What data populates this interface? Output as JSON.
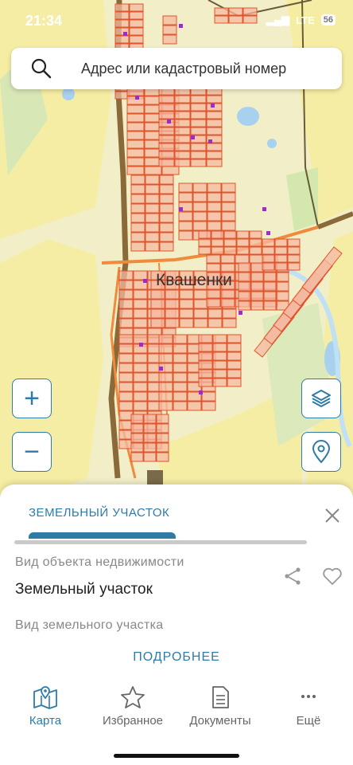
{
  "status_bar": {
    "time": "21:34",
    "network": "LTE",
    "battery": "56"
  },
  "search": {
    "placeholder": "Адрес или кадастровый номер"
  },
  "map": {
    "place_label": "Квашенки"
  },
  "map_controls": {
    "zoom_in": "+",
    "zoom_out": "−"
  },
  "sheet": {
    "tab_label": "ЗЕМЕЛЬНЫЙ УЧАСТОК",
    "field1_label": "Вид объекта недвижимости",
    "field1_value": "Земельный участок",
    "field2_label": "Вид земельного участка",
    "more_button": "ПОДРОБНЕЕ"
  },
  "bottom_nav": [
    {
      "label": "Карта",
      "icon": "map-icon",
      "active": true
    },
    {
      "label": "Избранное",
      "icon": "star-icon",
      "active": false
    },
    {
      "label": "Документы",
      "icon": "document-icon",
      "active": false
    },
    {
      "label": "Ещё",
      "icon": "more-dots-icon",
      "active": false
    }
  ],
  "colors": {
    "accent": "#2e7ba8",
    "parcel_fill": "#f4b8a0",
    "parcel_stroke": "#e0542c",
    "map_bg": "#f3efc6"
  }
}
